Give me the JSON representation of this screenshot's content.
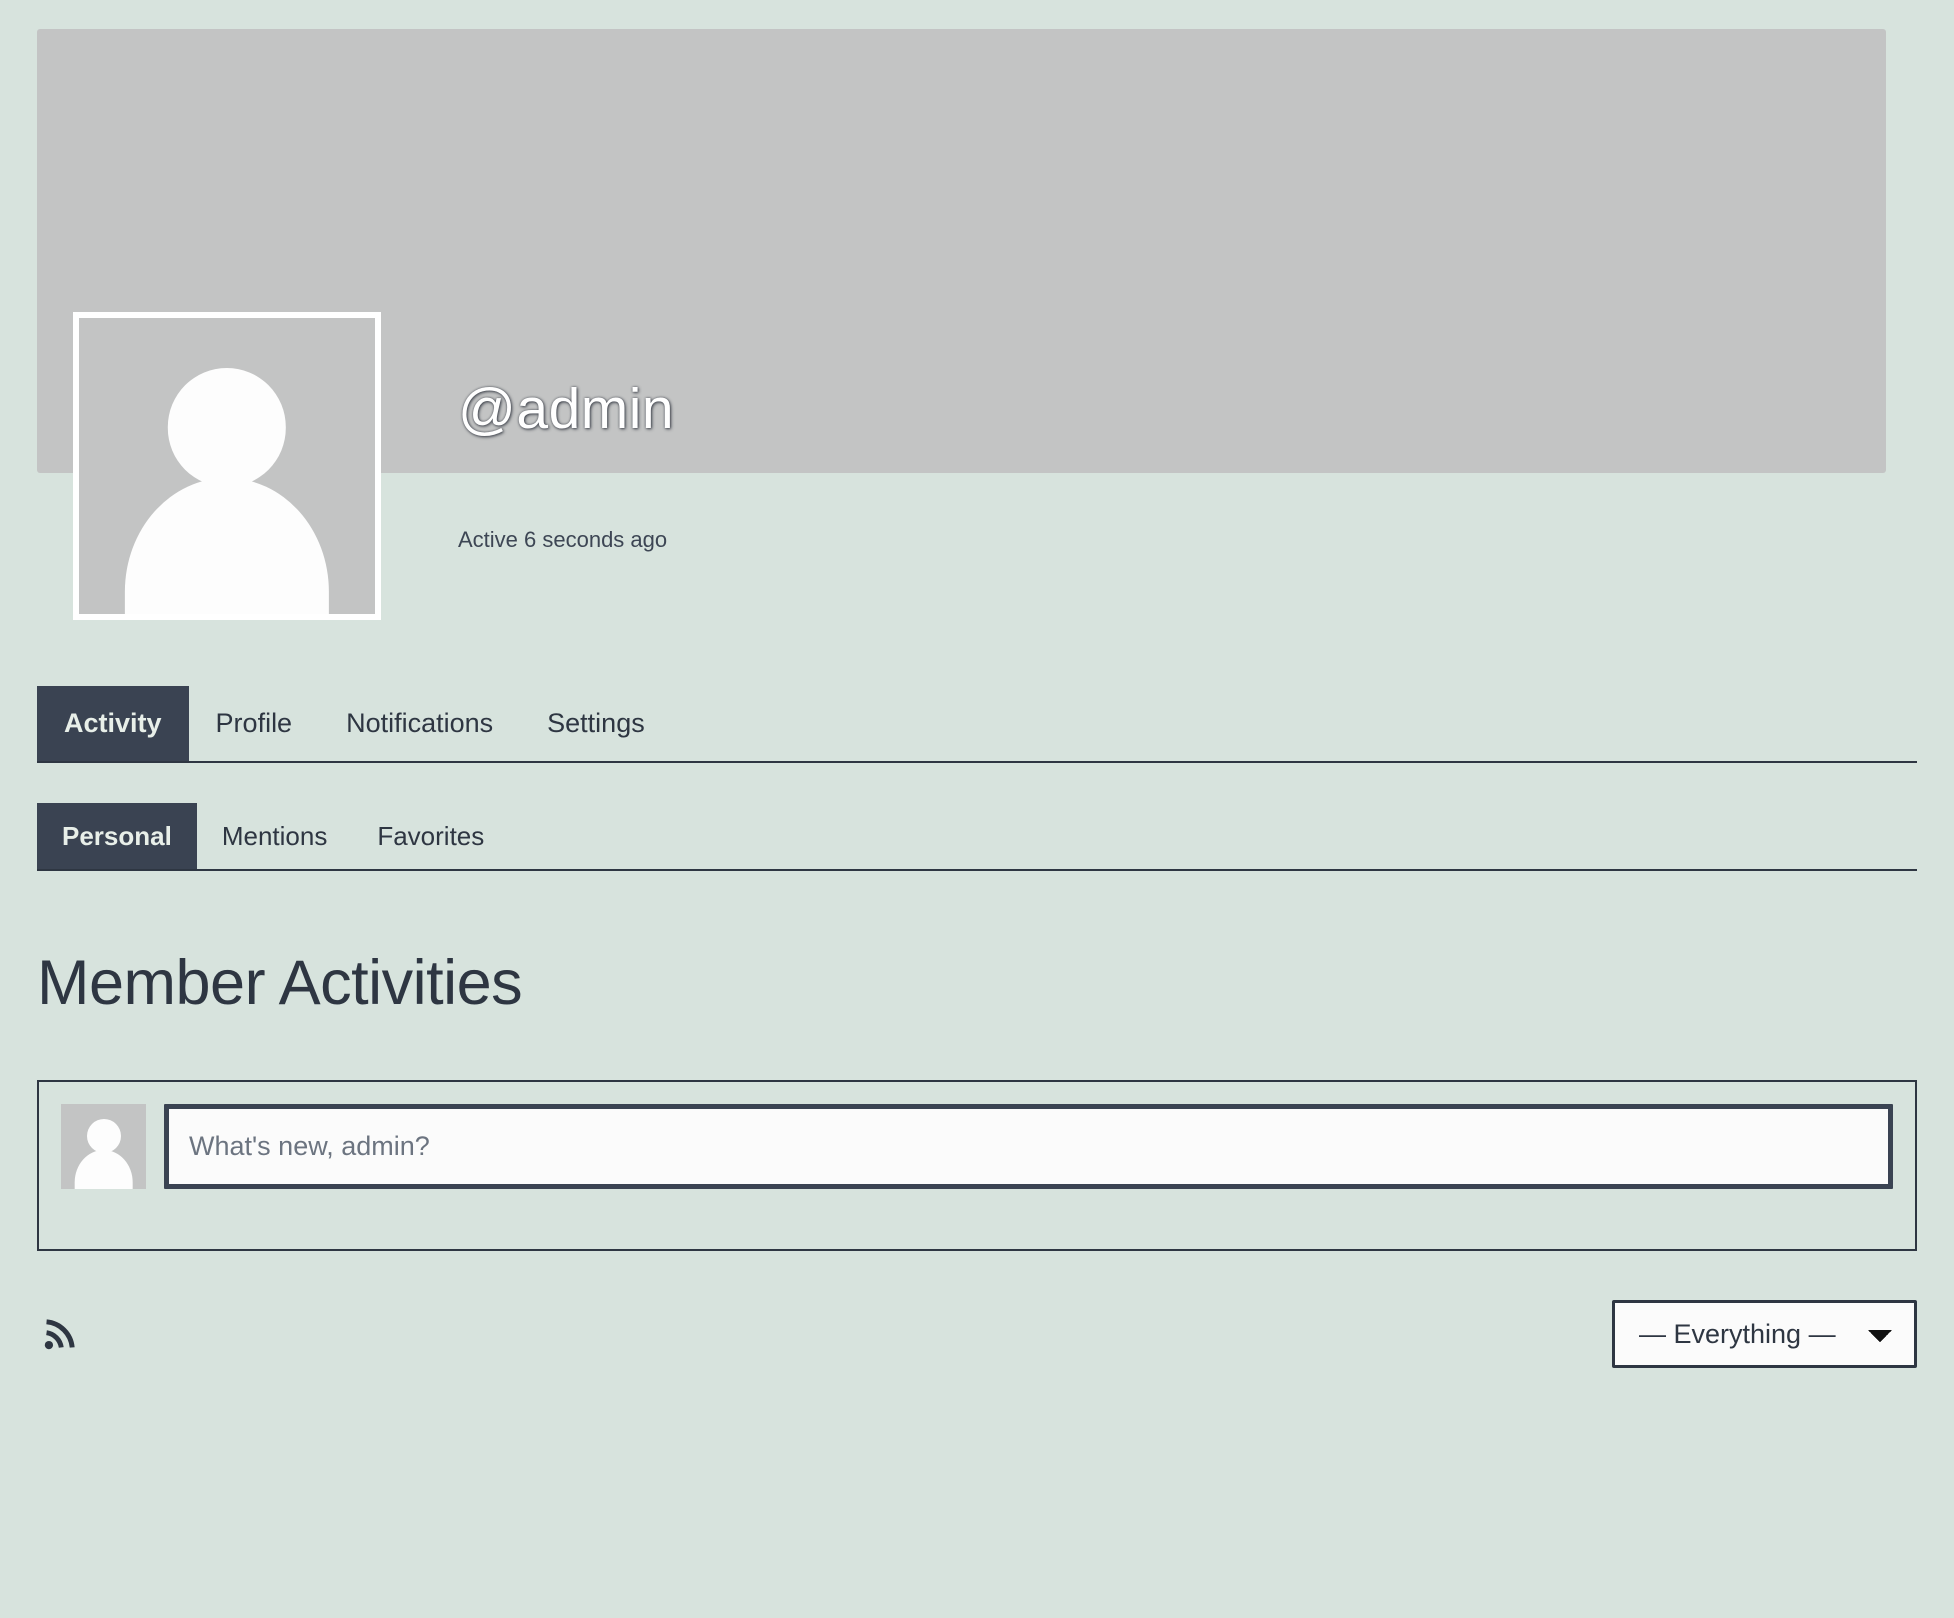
{
  "theme": {
    "page_background": "#d7e3dd",
    "accent_dark": "#3a4352",
    "text_color": "#2e3642",
    "cover_gray": "#c3c4c4",
    "input_background": "#fbfbfb"
  },
  "member_header": {
    "cover_image_name": "cover-image-placeholder",
    "avatar_name": "member-avatar-placeholder",
    "handle": "@admin",
    "last_active": "Active 6 seconds ago"
  },
  "primary_nav": {
    "items": [
      {
        "label": "Activity",
        "selected": true
      },
      {
        "label": "Profile",
        "selected": false
      },
      {
        "label": "Notifications",
        "selected": false
      },
      {
        "label": "Settings",
        "selected": false
      }
    ]
  },
  "secondary_nav": {
    "items": [
      {
        "label": "Personal",
        "selected": true
      },
      {
        "label": "Mentions",
        "selected": false
      },
      {
        "label": "Favorites",
        "selected": false
      }
    ]
  },
  "activity": {
    "page_title": "Member Activities",
    "post_form": {
      "avatar_name": "post-form-avatar",
      "input_placeholder": "What's new, admin?",
      "input_value": ""
    },
    "footer": {
      "rss_icon": "rss-icon",
      "filter": {
        "selected_label": "— Everything —",
        "options": [
          "— Everything —"
        ]
      }
    }
  }
}
